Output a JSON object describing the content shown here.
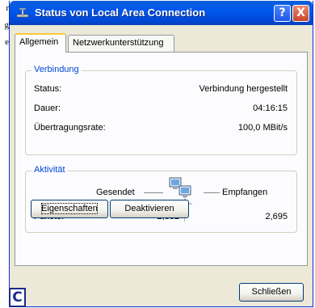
{
  "margin_text": [
    "r",
    "g",
    "e"
  ],
  "window": {
    "title": "Status von Local Area Connection",
    "help_glyph": "?",
    "close_glyph": "X"
  },
  "tabs": [
    {
      "label": "Allgemein",
      "active": true
    },
    {
      "label": "Netzwerkunterstützung",
      "active": false
    }
  ],
  "verbindung": {
    "legend": "Verbindung",
    "rows": [
      {
        "label": "Status:",
        "value": "Verbindung hergestellt"
      },
      {
        "label": "Dauer:",
        "value": "04:16:15"
      },
      {
        "label": "Übertragungsrate:",
        "value": "100,0 MBit/s"
      }
    ]
  },
  "aktivitaet": {
    "legend": "Aktivität",
    "sent_label": "Gesendet",
    "received_label": "Empfangen",
    "packets_label": "Pakete:",
    "packets_sent": "2,832",
    "packets_received": "2,695"
  },
  "buttons": {
    "eigenschaften": "Eigenschaften",
    "deaktivieren": "Deaktivieren",
    "schliessen": "Schließen"
  },
  "corner_badge": "C",
  "colors": {
    "titlebar": "#0058ee",
    "group_legend": "#0046d5",
    "dialog_bg": "#ece9d8",
    "panel_bg": "#fcfcfe"
  }
}
